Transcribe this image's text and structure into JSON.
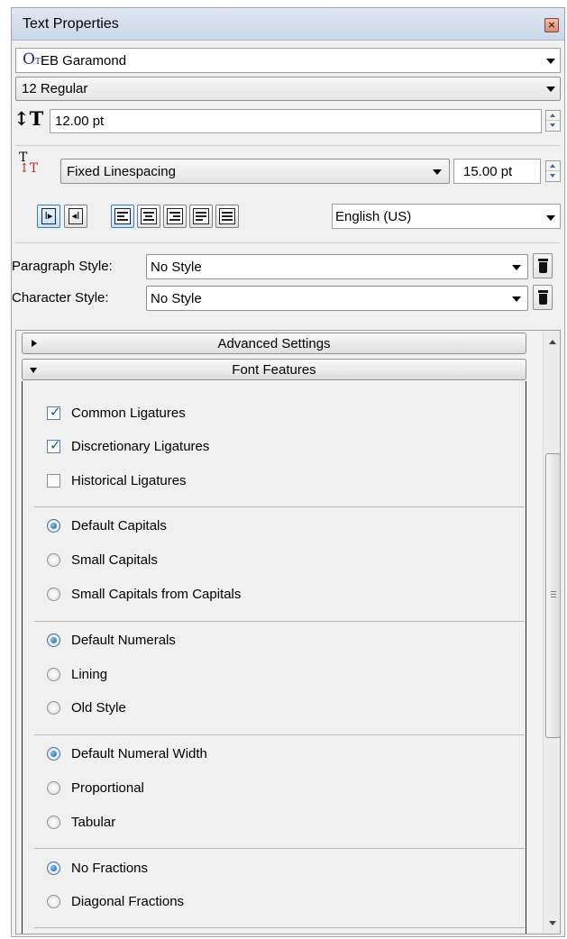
{
  "window": {
    "title": "Text Properties",
    "close_icon": "close-icon"
  },
  "font": {
    "family": "EB Garamond",
    "icon": "opentype-font-icon",
    "style": "12 Regular"
  },
  "font_size": {
    "value": "12.00 pt",
    "icon": "font-size-icon"
  },
  "line_spacing": {
    "mode": "Fixed Linespacing",
    "value": "15.00 pt",
    "icon": "line-spacing-icon"
  },
  "direction_buttons": [
    {
      "name": "ltr-direction-button",
      "icon": "ltr-direction-icon",
      "selected": true
    },
    {
      "name": "rtl-direction-button",
      "icon": "rtl-direction-icon",
      "selected": false
    }
  ],
  "alignment_buttons": [
    {
      "name": "align-left-button",
      "icon": "align-left-icon",
      "selected": true
    },
    {
      "name": "align-center-button",
      "icon": "align-center-icon",
      "selected": false
    },
    {
      "name": "align-right-button",
      "icon": "align-right-icon",
      "selected": false
    },
    {
      "name": "align-block-button",
      "icon": "align-block-icon",
      "selected": false
    },
    {
      "name": "align-forced-button",
      "icon": "align-forced-icon",
      "selected": false
    }
  ],
  "language": "English (US)",
  "paragraph_style": {
    "label": "Paragraph Style:",
    "value": "No Style"
  },
  "character_style": {
    "label": "Character Style:",
    "value": "No Style"
  },
  "sections": {
    "advanced": "Advanced Settings",
    "font_features": "Font Features"
  },
  "features": {
    "ligatures": [
      {
        "label": "Common Ligatures",
        "checked": true
      },
      {
        "label": "Discretionary Ligatures",
        "checked": true
      },
      {
        "label": "Historical Ligatures",
        "checked": false
      }
    ],
    "capitals": [
      {
        "label": "Default Capitals",
        "selected": true
      },
      {
        "label": "Small Capitals",
        "selected": false
      },
      {
        "label": "Small Capitals from Capitals",
        "selected": false
      }
    ],
    "numerals": [
      {
        "label": "Default Numerals",
        "selected": true
      },
      {
        "label": "Lining",
        "selected": false
      },
      {
        "label": "Old Style",
        "selected": false
      }
    ],
    "numeral_width": [
      {
        "label": "Default Numeral Width",
        "selected": true
      },
      {
        "label": "Proportional",
        "selected": false
      },
      {
        "label": "Tabular",
        "selected": false
      }
    ],
    "fractions": [
      {
        "label": "No Fractions",
        "selected": true
      },
      {
        "label": "Diagonal Fractions",
        "selected": false
      }
    ]
  },
  "colors": {
    "accent": "#3d7bad",
    "title_bar": "#c9d6e6",
    "panel": "#f0f0f0"
  }
}
